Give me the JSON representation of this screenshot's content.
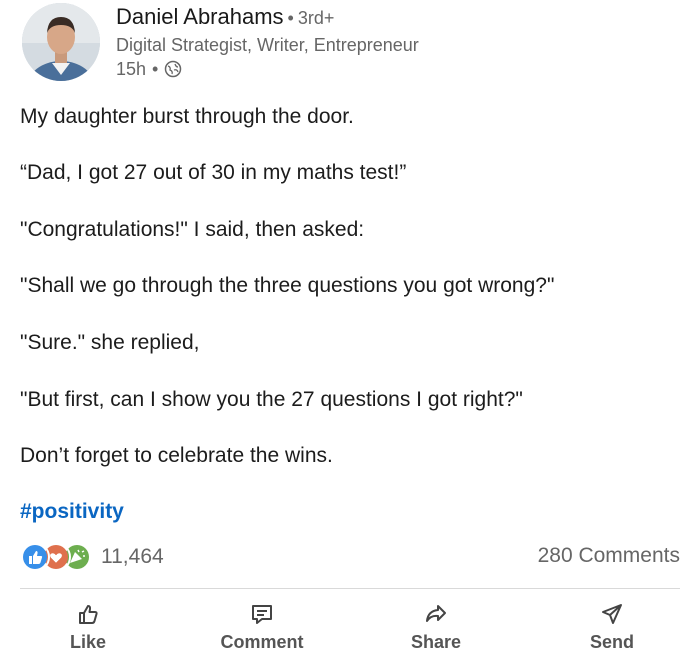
{
  "author": {
    "name": "Daniel Abrahams",
    "degree": "3rd+",
    "headline": "Digital Strategist, Writer, Entrepreneur",
    "time": "15h",
    "visibility_icon": "globe-icon"
  },
  "post": {
    "lines": [
      "My daughter burst through the door.",
      "“Dad, I got 27 out of 30 in my maths test!”",
      "\"Congratulations!\" I said, then asked:",
      "\"Shall we go through the three questions you got wrong?\"",
      "\"Sure.\" she replied,",
      "\"But first, can I show you the 27 questions I got right?\"",
      "Don’t forget to celebrate the wins."
    ],
    "hashtag": "#positivity"
  },
  "social": {
    "reaction_icons": [
      "like-icon",
      "love-icon",
      "celebrate-icon"
    ],
    "reaction_count": "11,464",
    "comments": "280 Comments"
  },
  "actions": {
    "like": "Like",
    "comment": "Comment",
    "share": "Share",
    "send": "Send"
  },
  "colors": {
    "link": "#0a66c2",
    "secondary_text": "#666666",
    "like": "#378fe9",
    "love": "#df704d",
    "celebrate": "#6dae4f"
  }
}
